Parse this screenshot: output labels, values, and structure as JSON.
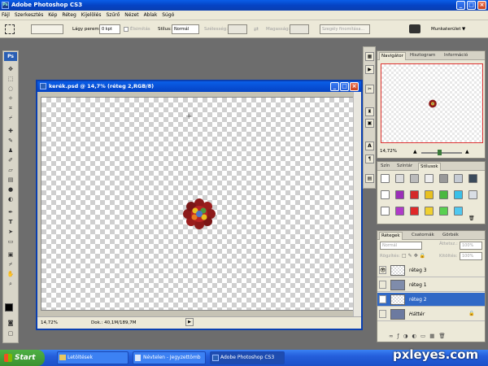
{
  "app": {
    "title": "Adobe Photoshop CS3",
    "ps_badge": "Ps"
  },
  "menu": [
    "Fájl",
    "Szerkesztés",
    "Kép",
    "Réteg",
    "Kijelölés",
    "Szűrő",
    "Nézet",
    "Ablak",
    "Súgó"
  ],
  "options": {
    "feather_label": "Lágy perem:",
    "feather_value": "0 kpt",
    "antialias_label": "Élsimítás",
    "style_label": "Stílus:",
    "style_value": "Normál",
    "width_label": "Szélesség:",
    "height_label": "Magasság:",
    "refine_button": "Szegély finomítása...",
    "workspace_label": "Munkaterület"
  },
  "document": {
    "title": "kerék.psd @ 14,7% (réteg 2,RGB/8)",
    "zoom": "14,72%",
    "doc_info": "Dok.: 40,1M/189,7M"
  },
  "navigator": {
    "tabs": [
      "Navigátor",
      "Hisztogram",
      "Információ"
    ],
    "zoom": "14,72%"
  },
  "styles_panel": {
    "tabs": [
      "Szín",
      "Színtár",
      "Stílusok"
    ]
  },
  "layers_panel": {
    "tabs": [
      "Rétegek",
      "Csatornák",
      "Görbék"
    ],
    "blend_mode": "Normál",
    "opacity_label": "Áttetsz.:",
    "opacity_value": "100%",
    "lock_label": "Rögzítés:",
    "fill_label": "Kitöltés:",
    "fill_value": "100%",
    "layers": [
      {
        "name": "réteg 3",
        "visible": true,
        "selected": false
      },
      {
        "name": "réteg 1",
        "visible": false,
        "selected": false
      },
      {
        "name": "réteg 2",
        "visible": false,
        "selected": true
      },
      {
        "name": "Háttér",
        "visible": false,
        "selected": false
      }
    ]
  },
  "taskbar": {
    "start": "Start",
    "tasks": [
      "Letöltések",
      "Névtelen - Jegyzettömb",
      "Adobe Photoshop CS3"
    ]
  },
  "watermark": "pxleyes.com",
  "colors": {
    "flower_red": "#8c1a1a",
    "flower_center_blue": "#4a78c8",
    "flower_yellow": "#e8c020",
    "selection_blue": "#3169c6"
  }
}
